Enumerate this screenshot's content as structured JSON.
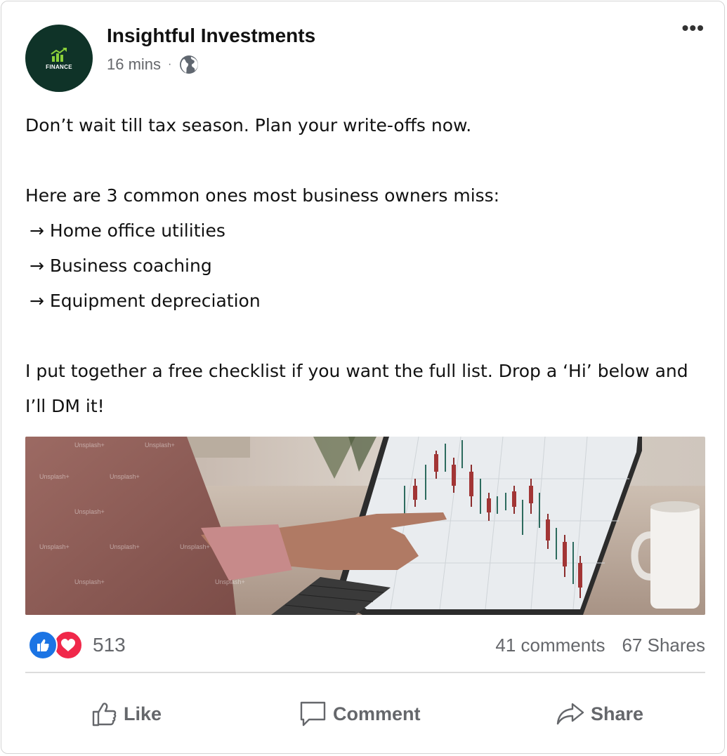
{
  "post": {
    "page_name": "Insightful Investments",
    "avatar_text": "FINANCE",
    "time": "16 mins",
    "separator": "·",
    "audience_icon": "globe-icon",
    "more_label": "•••",
    "text": {
      "line1": "Don’t wait till tax season. Plan your write-offs now.",
      "line2": "Here are 3 common ones most business owners miss:",
      "items": [
        "→ Home office utilities",
        "→ Business coaching",
        "→ Equipment depreciation"
      ],
      "line3": "I put together a free checklist if you want the full list. Drop a ‘Hi’ below and I’ll DM it!"
    },
    "image_watermark": "Unsplash+",
    "reactions": {
      "icons": [
        "like-icon",
        "love-icon"
      ],
      "count": "513"
    },
    "comments": "41 comments",
    "shares": "67 Shares",
    "actions": {
      "like": "Like",
      "comment": "Comment",
      "share": "Share"
    },
    "colors": {
      "avatar_bg": "#0f3328",
      "logo_green": "#8bd13a",
      "like_blue": "#1b74e4",
      "love_red": "#f0284a",
      "muted": "#65676b"
    }
  }
}
